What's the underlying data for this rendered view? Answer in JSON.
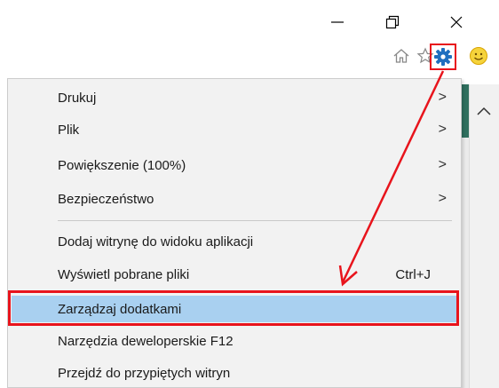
{
  "window_controls": {
    "minimize": "—",
    "restore": "❐",
    "close": "✕"
  },
  "toolbar_icons": [
    "home-icon",
    "star-icon",
    "gear-icon",
    "smiley-icon"
  ],
  "menu": {
    "items": [
      {
        "label": "Drukuj",
        "submenu": true
      },
      {
        "label": "Plik",
        "submenu": true
      },
      {
        "label": "Powiększenie (100%)",
        "submenu": true
      },
      {
        "label": "Bezpieczeństwo",
        "submenu": true
      },
      {
        "label": "Dodaj witrynę do widoku aplikacji"
      },
      {
        "label": "Wyświetl pobrane pliki",
        "shortcut": "Ctrl+J"
      },
      {
        "label": "Zarządzaj dodatkami",
        "highlighted": true
      },
      {
        "label": "Narzędzia deweloperskie F12"
      },
      {
        "label": "Przejdź do przypiętych witryn"
      }
    ],
    "chevron": ">"
  },
  "colors": {
    "highlight": "#a9d0f0",
    "annotation": "#e8141c",
    "gear": "#1f6fbf"
  }
}
